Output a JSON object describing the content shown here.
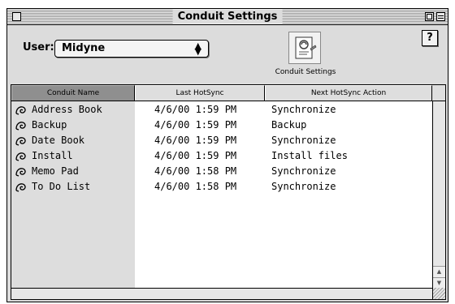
{
  "window": {
    "title": "Conduit Settings"
  },
  "user": {
    "label": "User:",
    "selected": "Midyne",
    "arrows": [
      "▲",
      "▼"
    ]
  },
  "conduit_button": {
    "label": "Conduit Settings",
    "icon": "conduit-settings-icon"
  },
  "help_button": {
    "label": "?"
  },
  "table": {
    "columns": [
      "Conduit Name",
      "Last HotSync",
      "Next HotSync Action"
    ],
    "sorted_column": "Conduit Name",
    "rows": [
      {
        "icon": "conduit-icon",
        "name": "Address Book",
        "last": "4/6/00 1:59 PM",
        "next": "Synchronize"
      },
      {
        "icon": "conduit-icon",
        "name": "Backup",
        "last": "4/6/00 1:59 PM",
        "next": "Backup"
      },
      {
        "icon": "conduit-icon",
        "name": "Date Book",
        "last": "4/6/00 1:59 PM",
        "next": "Synchronize"
      },
      {
        "icon": "conduit-icon",
        "name": "Install",
        "last": "4/6/00 1:59 PM",
        "next": "Install files"
      },
      {
        "icon": "conduit-icon",
        "name": "Memo Pad",
        "last": "4/6/00 1:58 PM",
        "next": "Synchronize"
      },
      {
        "icon": "conduit-icon",
        "name": "To Do List",
        "last": "4/6/00 1:58 PM",
        "next": "Synchronize"
      }
    ]
  },
  "colors": {
    "sorted_header": "#8f8f8f",
    "name_column_bg": "#dddddd"
  }
}
